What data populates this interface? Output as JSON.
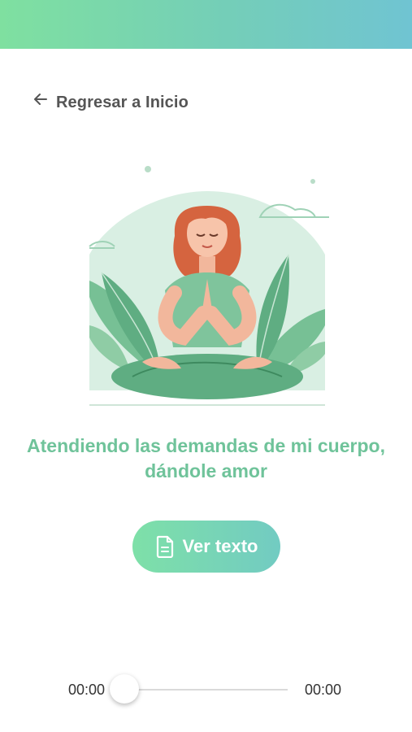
{
  "header": {
    "gradient_start": "#7fe0a0",
    "gradient_end": "#70c4d2"
  },
  "nav": {
    "back_label": "Regresar a Inicio",
    "back_icon": "arrow-left-icon"
  },
  "content": {
    "illustration": "meditating-woman-illustration",
    "title": "Atendiendo las demandas de mi cuerpo, dándole amor",
    "accent_color": "#6fc39a"
  },
  "actions": {
    "view_text_label": "Ver texto",
    "view_text_icon": "document-icon"
  },
  "player": {
    "current_time": "00:00",
    "total_time": "00:00",
    "progress": 0
  }
}
